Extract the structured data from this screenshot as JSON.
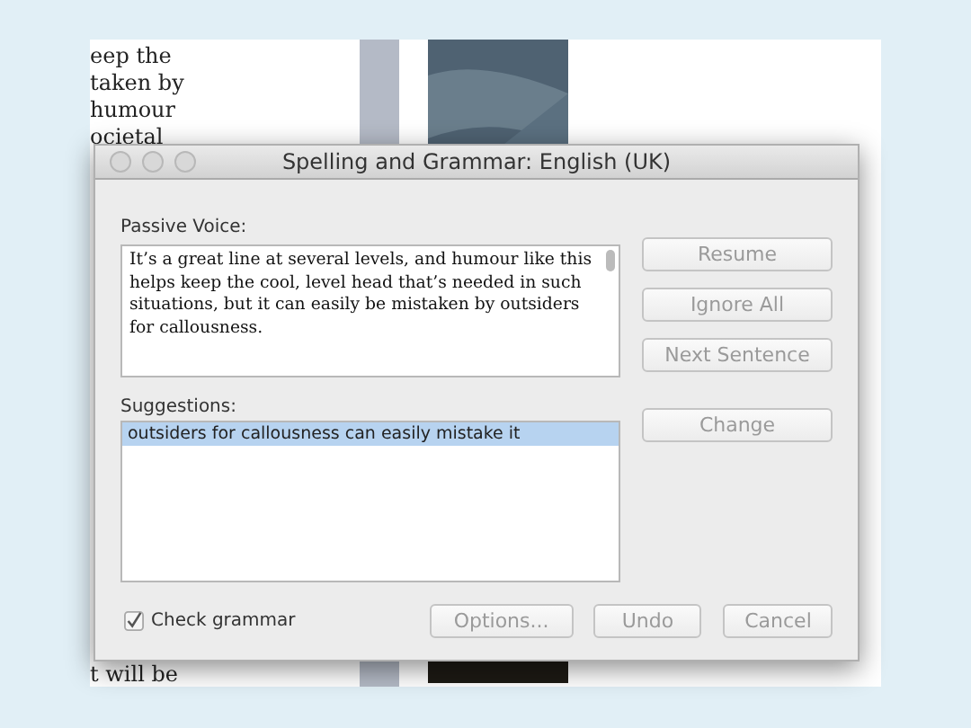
{
  "document": {
    "lines": [
      "eep the",
      "taken by",
      "humour",
      "ocietal"
    ],
    "bottom_line": "t will be"
  },
  "dialog": {
    "title": "Spelling and Grammar: English (UK)",
    "text_label": "Passive Voice:",
    "text": "It’s a great line at several levels, and humour like this helps keep the cool, level head that’s needed in such situations, but it can easily be mistaken by outsiders for callousness.",
    "side_buttons": [
      {
        "label": "Resume",
        "disabled": true
      },
      {
        "label": "Ignore All",
        "disabled": true
      },
      {
        "label": "Next Sentence",
        "disabled": true
      }
    ],
    "suggestions_label": "Suggestions:",
    "suggestions": [
      {
        "text": "outsiders for callousness can easily mistake it",
        "selected": true
      }
    ],
    "change_button": {
      "label": "Change",
      "disabled": true
    },
    "check_grammar": {
      "label": "Check grammar",
      "checked": true
    },
    "bottom_buttons": [
      {
        "label": "Options...",
        "disabled": true
      },
      {
        "label": "Undo",
        "disabled": true
      },
      {
        "label": "Cancel",
        "disabled": true
      }
    ]
  }
}
